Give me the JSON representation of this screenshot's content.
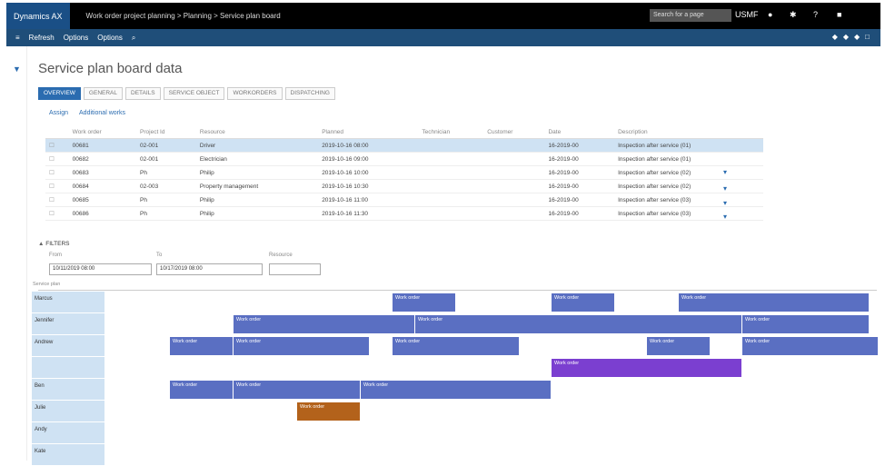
{
  "header": {
    "app_name": "Dynamics AX",
    "breadcrumb": "Work order project planning > Planning > Service plan board",
    "search_placeholder": "Search for a page",
    "user": "USMF"
  },
  "navbar": {
    "items": [
      "Refresh",
      "Options",
      "Options"
    ]
  },
  "page": {
    "title": "Service plan board data"
  },
  "tabs": [
    {
      "label": "OVERVIEW",
      "active": true
    },
    {
      "label": "GENERAL",
      "active": false
    },
    {
      "label": "DETAILS",
      "active": false
    },
    {
      "label": "SERVICE OBJECT",
      "active": false
    },
    {
      "label": "WORKORDERS",
      "active": false
    },
    {
      "label": "DISPATCHING",
      "active": false
    }
  ],
  "actions": [
    "Assign",
    "Additional works"
  ],
  "table": {
    "columns": [
      "",
      "Work order",
      "Project Id",
      "Resource",
      "Planned",
      "Technician",
      "Customer",
      "Date",
      "Description"
    ],
    "rows": [
      {
        "selected": true,
        "cells": [
          "",
          "00681",
          "02-001",
          "Driver",
          "2019-10-16 08:00",
          "",
          "",
          "16-2019-00",
          "Inspection after service (01)"
        ]
      },
      {
        "selected": false,
        "cells": [
          "",
          "00682",
          "02-001",
          "Electrician",
          "2019-10-16 09:00",
          "",
          "",
          "16-2019-00",
          "Inspection after service (01)"
        ]
      },
      {
        "selected": false,
        "cells": [
          "",
          "00683",
          "Ph",
          "Philip",
          "2019-10-16 10:00",
          "",
          "",
          "16-2019-00",
          "Inspection after service (02)"
        ]
      },
      {
        "selected": false,
        "cells": [
          "",
          "00684",
          "02-003",
          "Property management",
          "2019-10-16 10:30",
          "",
          "",
          "16-2019-00",
          "Inspection after service (02)"
        ]
      },
      {
        "selected": false,
        "cells": [
          "",
          "00685",
          "Ph",
          "Philip",
          "2019-10-16 11:00",
          "",
          "",
          "16-2019-00",
          "Inspection after service (03)"
        ]
      },
      {
        "selected": false,
        "cells": [
          "",
          "00686",
          "Ph",
          "Philip",
          "2019-10-16 11:30",
          "",
          "",
          "16-2019-00",
          "Inspection after service (03)"
        ]
      }
    ]
  },
  "filters": {
    "section_label": "FILTERS",
    "from_label": "From",
    "from_value": "10/11/2019 08:00",
    "to_label": "To",
    "to_value": "10/17/2019 08:00",
    "resource_label": "Resource",
    "resource_value": ""
  },
  "board": {
    "title": "Service plan",
    "resources": [
      "Marcus",
      "Jennifer",
      "Andrew",
      "",
      "Ben",
      "Julie",
      "Andy",
      "Kate"
    ],
    "bars_text": [
      "Work order"
    ]
  }
}
